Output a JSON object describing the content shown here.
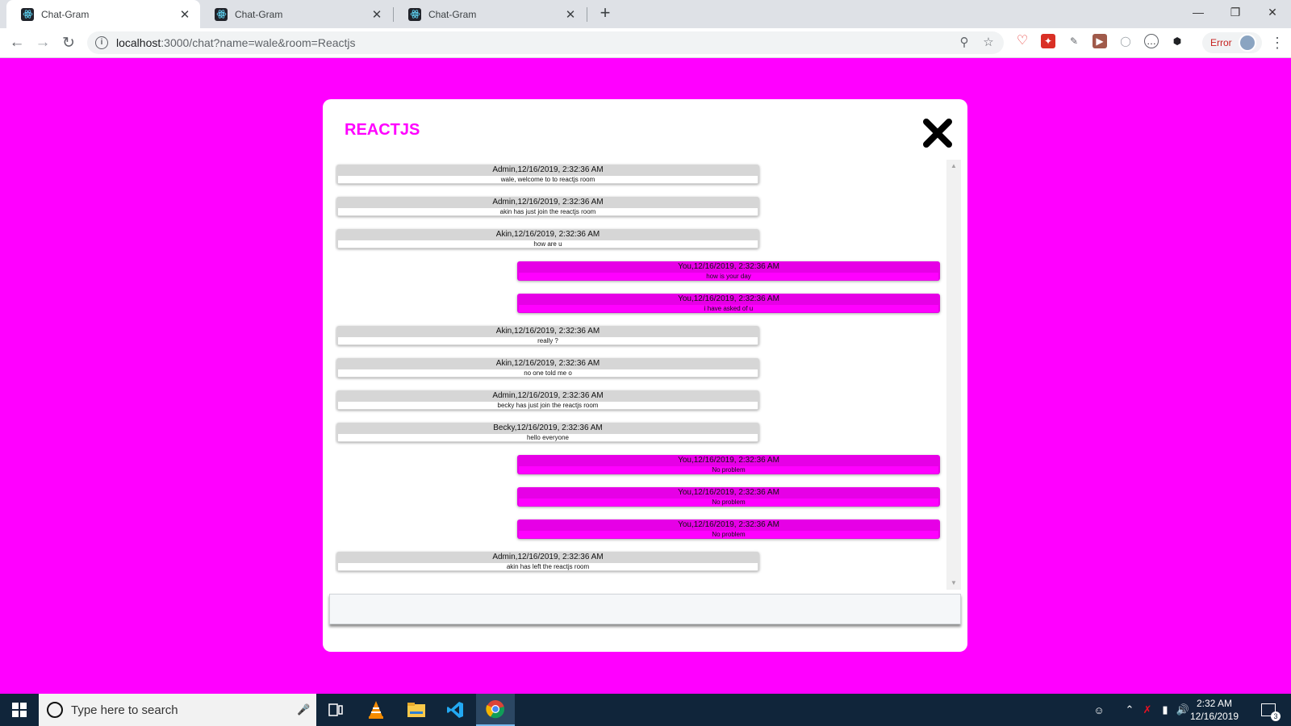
{
  "browser": {
    "tabs": [
      {
        "title": "Chat-Gram",
        "active": true
      },
      {
        "title": "Chat-Gram",
        "active": false
      },
      {
        "title": "Chat-Gram",
        "active": false
      }
    ],
    "tab_close_glyph": "✕",
    "new_tab_glyph": "+",
    "url_host": "localhost",
    "url_path": ":3000/chat?name=wale&room=Reactjs",
    "error_label": "Error",
    "icons": [
      "back-icon",
      "forward-icon",
      "reload-icon",
      "info-icon",
      "zoom-icon",
      "star-icon"
    ]
  },
  "chat": {
    "room_title": "REACTJS",
    "accent_color": "#ff00ff",
    "messages": [
      {
        "sender": "Admin",
        "meta": "Admin,12/16/2019, 2:32:36 AM",
        "text": "wale, welcome to to reactjs room",
        "self": false
      },
      {
        "sender": "Admin",
        "meta": "Admin,12/16/2019, 2:32:36 AM",
        "text": "akin has just join the reactjs room",
        "self": false
      },
      {
        "sender": "Akin",
        "meta": "Akin,12/16/2019, 2:32:36 AM",
        "text": "how are u",
        "self": false
      },
      {
        "sender": "You",
        "meta": "You,12/16/2019, 2:32:36 AM",
        "text": "how is your day",
        "self": true
      },
      {
        "sender": "You",
        "meta": "You,12/16/2019, 2:32:36 AM",
        "text": "i have asked of u",
        "self": true
      },
      {
        "sender": "Akin",
        "meta": "Akin,12/16/2019, 2:32:36 AM",
        "text": "really ?",
        "self": false
      },
      {
        "sender": "Akin",
        "meta": "Akin,12/16/2019, 2:32:36 AM",
        "text": "no one told me o",
        "self": false
      },
      {
        "sender": "Admin",
        "meta": "Admin,12/16/2019, 2:32:36 AM",
        "text": "becky has just join the reactjs room",
        "self": false
      },
      {
        "sender": "Becky",
        "meta": "Becky,12/16/2019, 2:32:36 AM",
        "text": "hello everyone",
        "self": false
      },
      {
        "sender": "You",
        "meta": "You,12/16/2019, 2:32:36 AM",
        "text": "No problem",
        "self": true
      },
      {
        "sender": "You",
        "meta": "You,12/16/2019, 2:32:36 AM",
        "text": "No problem",
        "self": true
      },
      {
        "sender": "You",
        "meta": "You,12/16/2019, 2:32:36 AM",
        "text": "No problem",
        "self": true
      },
      {
        "sender": "Admin",
        "meta": "Admin,12/16/2019, 2:32:36 AM",
        "text": "akin has left the reactjs room",
        "self": false
      }
    ],
    "input_value": ""
  },
  "taskbar": {
    "search_placeholder": "Type here to search",
    "time": "2:32 AM",
    "date": "12/16/2019",
    "notification_count": "3",
    "apps": [
      "task-view-icon",
      "vlc-icon",
      "file-explorer-icon",
      "vscode-icon",
      "chrome-icon"
    ]
  }
}
